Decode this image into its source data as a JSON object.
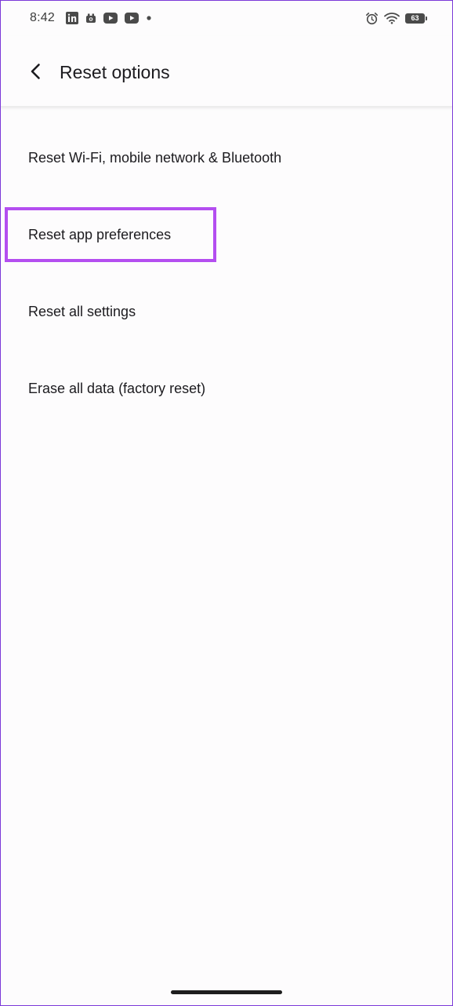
{
  "status_bar": {
    "time": "8:42",
    "left_icons": [
      "linkedin-icon",
      "camera-notification-icon",
      "youtube-icon",
      "youtube-icon",
      "more-notifications-dot-icon"
    ],
    "right_icons": [
      "alarm-icon",
      "wifi-icon",
      "battery-icon"
    ],
    "battery_level": "63"
  },
  "app_bar": {
    "back_icon": "back-arrow-icon",
    "title": "Reset options"
  },
  "options": [
    {
      "label": "Reset Wi-Fi, mobile network & Bluetooth"
    },
    {
      "label": "Reset app preferences",
      "highlighted": true
    },
    {
      "label": "Reset all settings"
    },
    {
      "label": "Erase all data (factory reset)"
    }
  ],
  "colors": {
    "highlight": "#b44ef0",
    "frame": "#7b39d8",
    "background": "#fdfcfd",
    "text": "#1c1b1f"
  }
}
